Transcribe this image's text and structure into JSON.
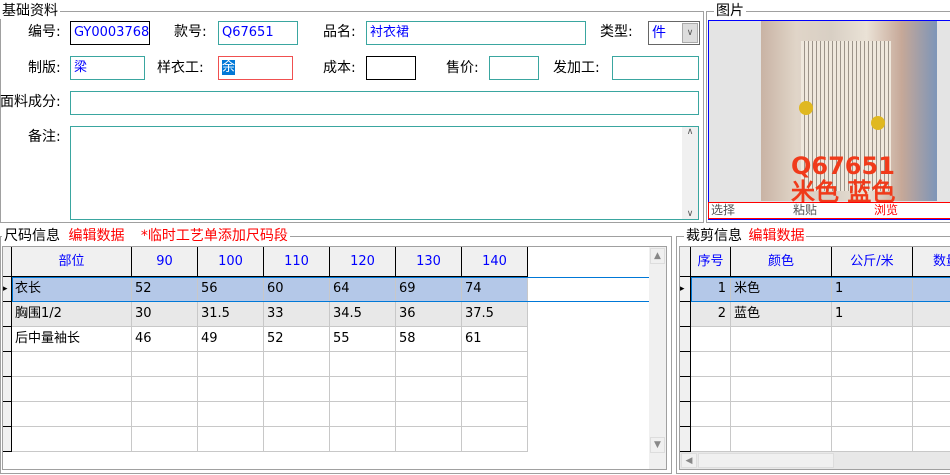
{
  "basic": {
    "title": "基础资料",
    "code_label": "编号:",
    "code": "GY0003768",
    "style_label": "款号:",
    "style_no": "Q67651",
    "name_label": "品名:",
    "name": "衬衣裙",
    "type_label": "类型:",
    "type": "件",
    "pattern_label": "制版:",
    "pattern": "梁",
    "sample_label": "样衣工:",
    "sample": "余",
    "cost_label": "成本:",
    "cost": "",
    "price_label": "售价:",
    "price": "",
    "outsource_label": "发加工:",
    "outsource": "",
    "fabric_label": "面料成分:",
    "fabric": "",
    "remark_label": "备注:",
    "remark": ""
  },
  "picture": {
    "title": "图片",
    "overlay_code": "Q67651",
    "overlay_colors": "米色 蓝色",
    "select": "选择",
    "paste": "粘贴",
    "browse": "浏览"
  },
  "size": {
    "title": "尺码信息",
    "edit": "编辑数据",
    "note": "*临时工艺单添加尺码段",
    "columns": [
      "部位",
      "90",
      "100",
      "110",
      "120",
      "130",
      "140"
    ],
    "rows": [
      [
        "衣长",
        "52",
        "56",
        "60",
        "64",
        "69",
        "74"
      ],
      [
        "胸围1/2",
        "30",
        "31.5",
        "33",
        "34.5",
        "36",
        "37.5"
      ],
      [
        "后中量袖长",
        "46",
        "49",
        "52",
        "55",
        "58",
        "61"
      ]
    ]
  },
  "cut": {
    "title": "裁剪信息",
    "edit": "编辑数据",
    "columns": [
      "序号",
      "颜色",
      "公斤/米",
      "数量"
    ],
    "rows": [
      [
        "1",
        "米色",
        "1",
        ""
      ],
      [
        "2",
        "蓝色",
        "1",
        ""
      ]
    ]
  },
  "colors": {
    "accent_blue": "#0000ff",
    "selected_row": "#b4c8e8",
    "red": "#ff0000"
  }
}
